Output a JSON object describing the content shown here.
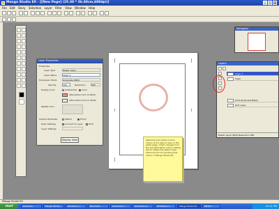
{
  "window": {
    "title": "Manga Studio EX - [[New Page] (25.30 * 36.40cm,600dpi)]"
  },
  "menu": [
    "File",
    "Edit",
    "Story",
    "Selection",
    "Layer",
    "Filter",
    "View",
    "Window",
    "Help"
  ],
  "layer_properties": {
    "title": "Layer Properties",
    "section": "Properties",
    "layer_type_label": "Layer Type",
    "layer_type_value": "Raster Layer",
    "layer_name_label": "Layer Name",
    "layer_name_value": "Layer 2",
    "expression_mode_label": "Expression Mode",
    "expression_mode_value": "Grayscale (8bit)",
    "opacity_label": "Opacity",
    "opacity_value": "100",
    "resolution_label": "Resolution",
    "resolution_value": "600",
    "display_color_label": "Display Color",
    "subtractive_label": "Subtractive",
    "color_label": "Color",
    "alt_black_label": "Alternative Color to Black",
    "alt_white_label": "Alternative Color to White",
    "palette_color_label": "Palette Color",
    "output_attributes_label": "Output Attributes",
    "sketch_label": "Sketch",
    "finish_label": "Finish",
    "ruler_settings_label": "Ruler Settings",
    "connect_label": "Connect to Layer",
    "hide_label": "Hide",
    "layer_settings_label": "Layer Settings",
    "display_button": "Display View",
    "alt_black_color": "#f08c84"
  },
  "note": {
    "text": "Sketched and inked circle in colour so it's easy to see on the white page. I then changed it to the red alternative colour setting which makes the sketch layer stand out as non-printing blue colour in Manga Studio EX."
  },
  "navigator": {
    "title": "Navigator"
  },
  "layers": {
    "title": "Layers",
    "rows": [
      {
        "label": "Layer 2",
        "selected": true
      },
      {
        "label": "Layer",
        "selected": false
      },
      {
        "label": "Print Guide and Bleed",
        "selected": false
      },
      {
        "label": "Grid Layer",
        "selected": false
      }
    ],
    "footer": "Raster Layer (8bit) Resolution 600"
  },
  "statusbar": {
    "text": "Manga Studio EX"
  },
  "taskbar": {
    "start": "start",
    "tasks": [
      "Windows...",
      "Manga Studio...",
      "Windows Li...",
      "Microsoft...",
      "Windows Li...",
      "Windows La...",
      "Windows Li...",
      "Manga Studio EX",
      "INFOLY"
    ],
    "clock": "10:11 PM"
  },
  "colors": {
    "title_blue": "#2b58c8",
    "circle": "#e8b0a6",
    "note_yellow": "#fff99a",
    "annotation_red": "#e02020"
  }
}
